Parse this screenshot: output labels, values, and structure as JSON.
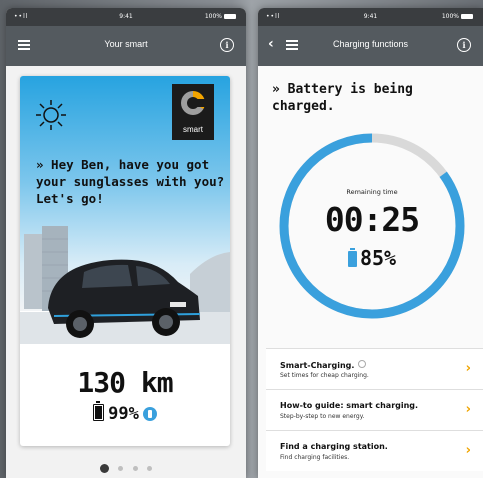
{
  "left_screen": {
    "status": {
      "signal": "••ll",
      "time": "9:41",
      "battery": "100%"
    },
    "header": {
      "title": "Your smart"
    },
    "card": {
      "brand": "smart",
      "headline": "» Hey Ben, have you got your sunglasses with you? Let's go!",
      "range": "130 km",
      "charge": "99%"
    },
    "pager": {
      "pages": 4,
      "active": 0
    }
  },
  "right_screen": {
    "status": {
      "signal": "••ll",
      "time": "9:41",
      "battery": "100%"
    },
    "header": {
      "title": "Charging functions"
    },
    "status_title": "» Battery is being charged.",
    "gauge": {
      "label": "Remaining time",
      "time": "00:25",
      "percent": "85%",
      "progress": 0.85
    },
    "menu": [
      {
        "title": "Smart-Charging.",
        "subtitle": "Set times for cheap charging."
      },
      {
        "title": "How-to guide: smart charging.",
        "subtitle": "Step-by-step to new energy."
      },
      {
        "title": "Find a charging station.",
        "subtitle": "Find charging facilities."
      }
    ]
  },
  "colors": {
    "accent": "#3aa0dd",
    "arrow": "#f0a500",
    "navbar": "#545a5f"
  }
}
